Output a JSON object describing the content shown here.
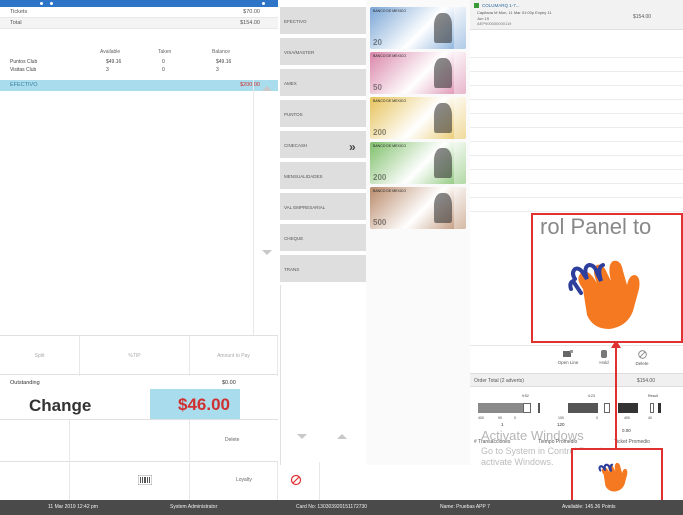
{
  "summary": {
    "tickets_label": "Tickets",
    "tickets_value": "$70.00",
    "total_label": "Total",
    "total_value": "$154.00",
    "balance_headers": [
      "Available",
      "Taken",
      "Balance"
    ],
    "balance_rows": [
      {
        "name": "Puntos Club",
        "available": "$49.16",
        "taken": "0",
        "balance": "$49.16"
      },
      {
        "name": "Visitas Club",
        "available": "3",
        "taken": "0",
        "balance": "3"
      }
    ],
    "selected_method": "EFECTIVO",
    "selected_amount": "$200.00"
  },
  "split_row": {
    "split": "Split",
    "tip": "%TIP",
    "amount_to_pay": "Amount to Pay"
  },
  "outstanding": {
    "label": "Outstanding",
    "value": "$0.00"
  },
  "change": {
    "label": "Change",
    "value": "$46.00"
  },
  "delete_label": "Delete",
  "loyalty_label": "Loyalty",
  "payment_methods": [
    "EFECTIVO",
    "VISA/MASTER",
    "AMEX",
    "PUNTOS",
    "CINECASH",
    "MENSUALIDADES",
    "VAL EMPRESARIAL",
    "CHEQUE",
    "TRANS"
  ],
  "bills": [
    {
      "den": "20",
      "bank": "BANCO DE MEXICO",
      "color": "#7aa6d6"
    },
    {
      "den": "50",
      "bank": "BANCO DE MEXICO",
      "color": "#d985a8"
    },
    {
      "den": "200",
      "bank": "BANCO DE MEXICO",
      "color": "#e6c25a"
    },
    {
      "den": "200",
      "bank": "BANCO DE MEXICO",
      "color": "#7fbf6a"
    },
    {
      "den": "500",
      "bank": "BANCO DE MEXICO",
      "color": "#b98a6a"
    }
  ],
  "order_item": {
    "title": "COLUMARQ 1-7...",
    "line2": "Capitana M Mon, 11 Mar 01:00p Expiry 11",
    "line3": "Jun 19",
    "line4": "AEP900000000119",
    "price": "$154.00"
  },
  "actions": {
    "open_line": "Open Line",
    "hold": "Hold",
    "delete": "Delete"
  },
  "order_total": {
    "label": "Order Total (2 adverts)",
    "value": "$154.00"
  },
  "gauge": {
    "top_ticks": [
      "9:52",
      "4:23",
      "Result"
    ],
    "bottom_ticks": [
      "400",
      "90",
      "0",
      "100",
      "0",
      "400",
      "40"
    ]
  },
  "stats": {
    "transactions_label": "# Transacciones",
    "avg_time_label": "Tiempo Promedio",
    "avg_ticket_label": "Ticket Promedio",
    "transactions_value": "1",
    "avg_time_value": "120",
    "avg_ticket_value": "0.00"
  },
  "watermark": {
    "line1": "Activate Windows",
    "line2": "Go to System in Control Panel to",
    "line3": "activate Windows."
  },
  "popup_text": "rol Panel to",
  "status": {
    "datetime": "11 Mar 2019 12:42 pm",
    "user": "System Administrator",
    "card": "Card No: 130303920151172730",
    "name": "Name: Pruebas APP 7",
    "available": "Available: 145.36 Points"
  },
  "colors": {
    "accent": "#a9dced",
    "change_red": "#d03030",
    "highlight_border": "#e03030"
  }
}
